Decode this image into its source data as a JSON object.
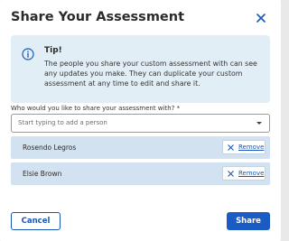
{
  "modal": {
    "title": "Share Your Assessment",
    "close_icon": "close-icon"
  },
  "tip": {
    "icon": "info-icon",
    "title": "Tip!",
    "body": "The people you share your custom assessment with can see any updates you make. They can duplicate your custom assessment at any time to edit and share it."
  },
  "share_field": {
    "label": "Who would you like to share your assessment with? *",
    "placeholder": "Start typing to add a person",
    "caret_icon": "caret-down-icon"
  },
  "shared_people": [
    {
      "name": "Rosendo Legros",
      "remove_label": "Remove"
    },
    {
      "name": "Elsie Brown",
      "remove_label": "Remove"
    }
  ],
  "footer": {
    "cancel_label": "Cancel",
    "share_label": "Share"
  },
  "colors": {
    "accent": "#1b5cc4",
    "tip_background": "#e2eef5",
    "person_row_background": "#d3e2f0"
  }
}
